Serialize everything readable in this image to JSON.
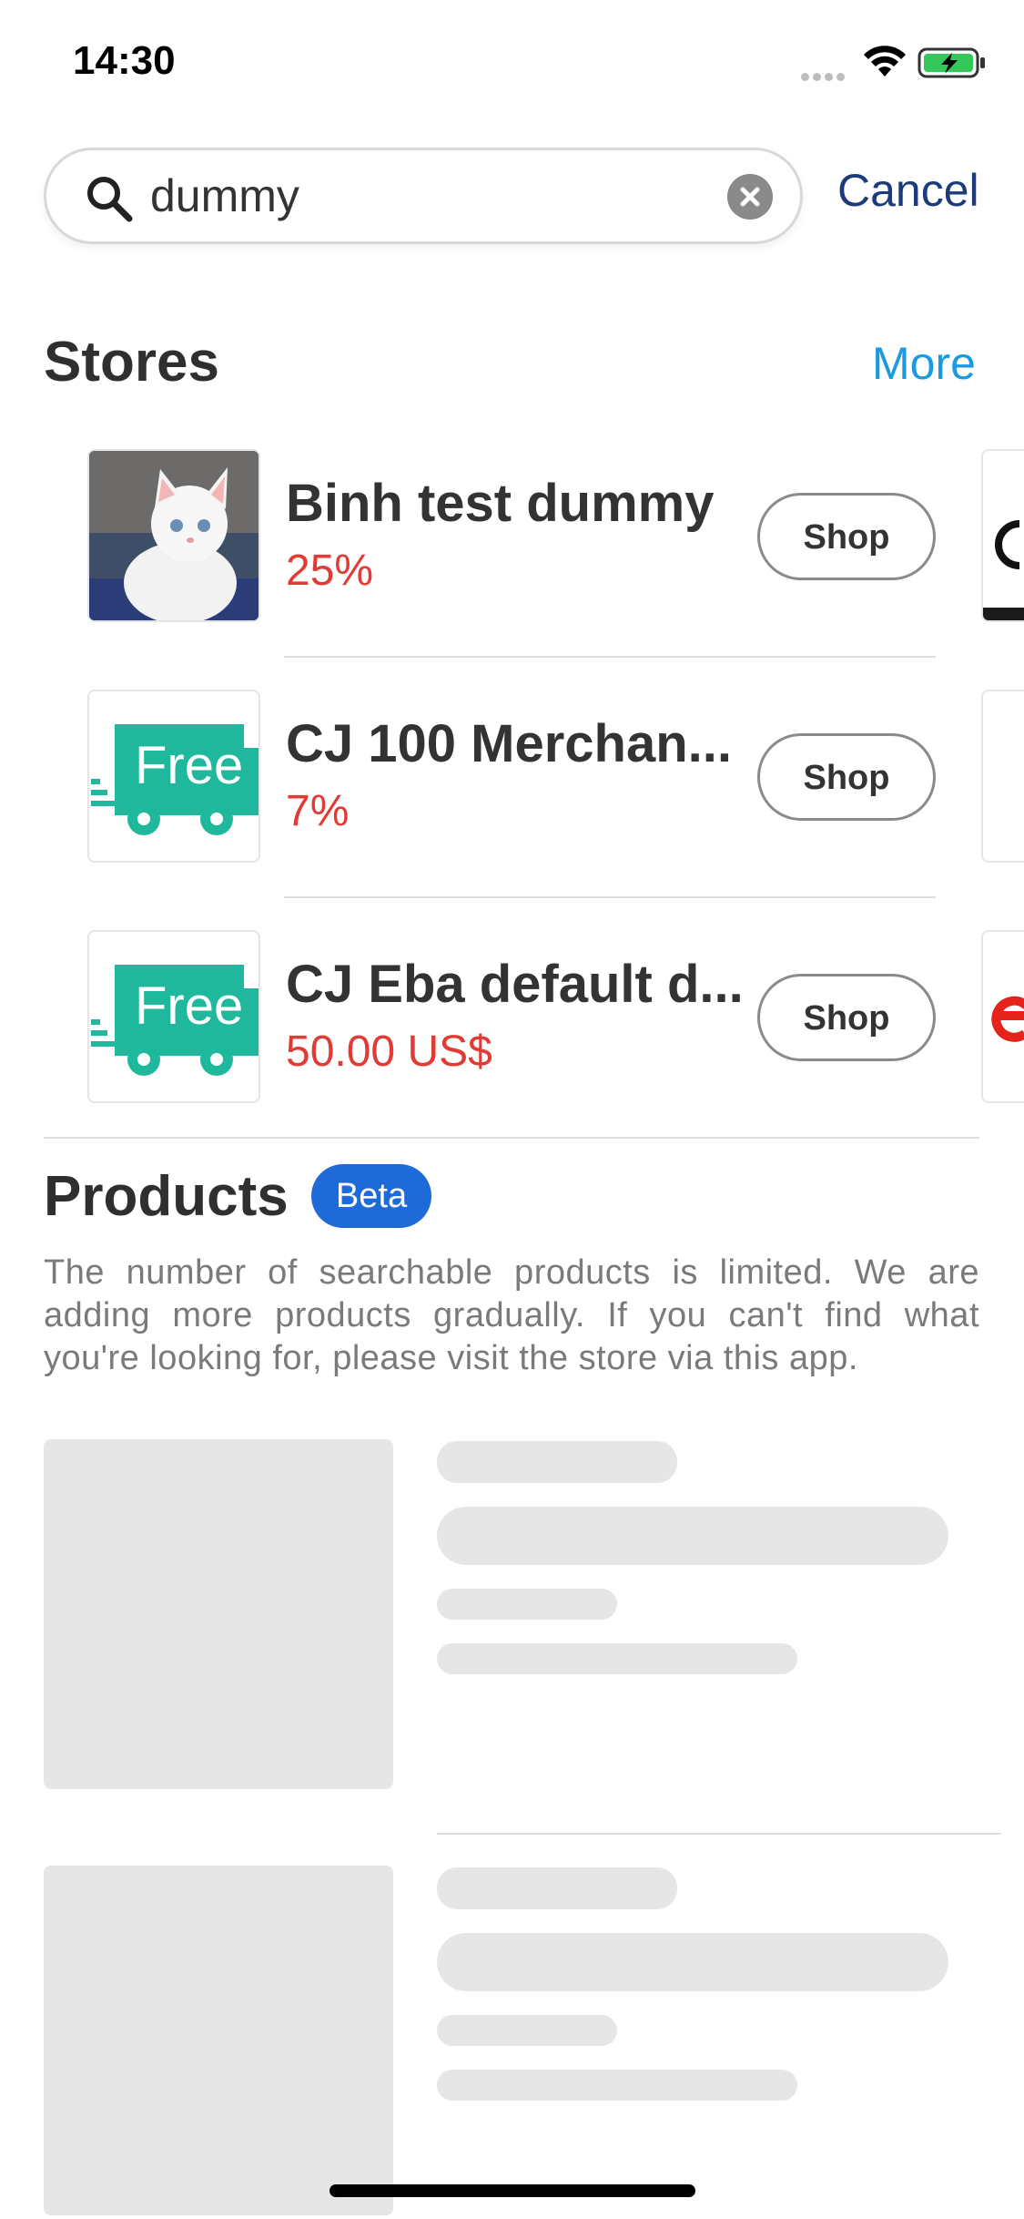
{
  "status_bar": {
    "time": "14:30",
    "battery_color": "#34c759"
  },
  "search": {
    "value": "dummy",
    "cancel_label": "Cancel"
  },
  "stores_section": {
    "title": "Stores",
    "more_label": "More",
    "items": [
      {
        "name": "Binh test dummy",
        "rate": "25%",
        "shop_label": "Shop",
        "thumb": "kitten-photo"
      },
      {
        "name": "CJ 100 Merchan...",
        "rate": "7%",
        "shop_label": "Shop",
        "thumb": "free-shipping-truck"
      },
      {
        "name": "CJ Eba default d...",
        "rate": "50.00 US$",
        "shop_label": "Shop",
        "thumb": "free-shipping-truck"
      }
    ]
  },
  "products_section": {
    "title": "Products",
    "badge": "Beta",
    "note": "The number of searchable products is limited. We are adding more products gradually. If you can't find what you're looking for, please visit the store via this app."
  },
  "colors": {
    "accent_blue": "#1a9ae0",
    "cancel_navy": "#1b3b7a",
    "rate_red": "#e23a34",
    "badge_blue": "#1e6ad8",
    "truck_teal": "#1fb89c"
  },
  "thumb_labels": {
    "free": "Free"
  }
}
